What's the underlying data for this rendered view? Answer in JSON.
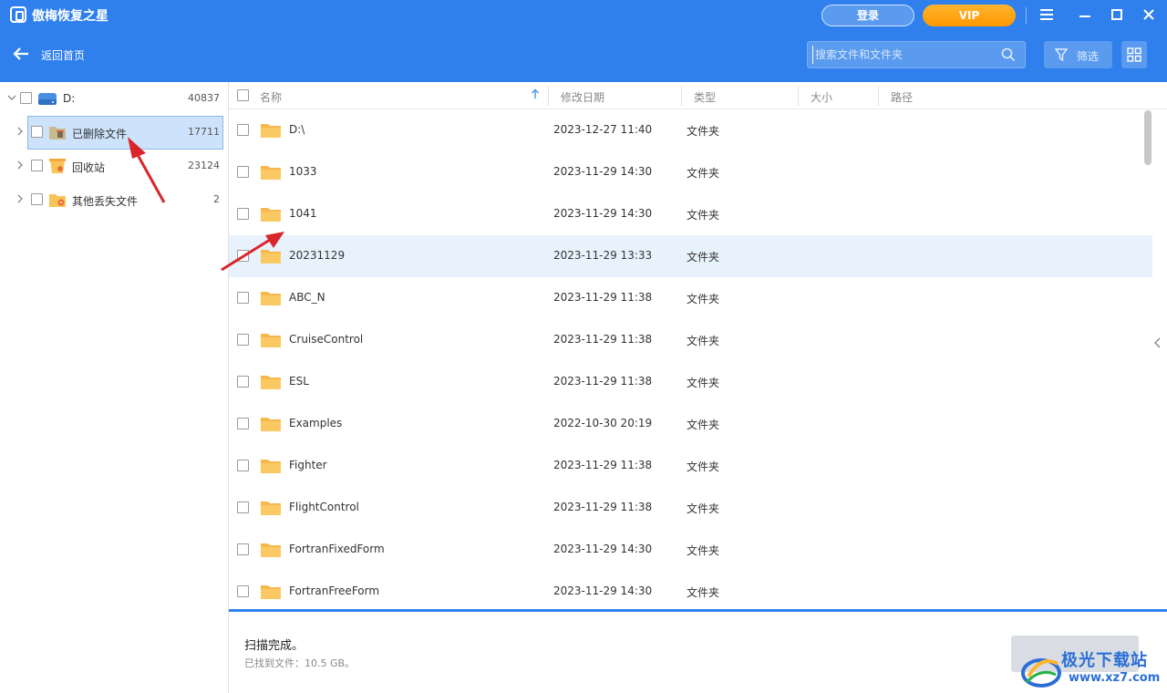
{
  "app": {
    "title": "傲梅恢复之星",
    "login_label": "登录",
    "vip_label": "VIP"
  },
  "toolbar": {
    "back_label": "返回首页",
    "search_placeholder": "搜索文件和文件夹",
    "filter_label": "筛选"
  },
  "sidebar": {
    "drive": {
      "label": "D:",
      "count": "40837"
    },
    "items": [
      {
        "label": "已删除文件",
        "count": "17711",
        "icon": "deleted-folder-icon",
        "selected": true
      },
      {
        "label": "回收站",
        "count": "23124",
        "icon": "recycle-bin-icon",
        "selected": false
      },
      {
        "label": "其他丢失文件",
        "count": "2",
        "icon": "lost-files-icon",
        "selected": false
      }
    ]
  },
  "table": {
    "columns": [
      "名称",
      "修改日期",
      "类型",
      "大小",
      "路径"
    ],
    "rows": [
      {
        "name": "D:\\",
        "date": "2023-12-27 11:40",
        "type": "文件夹"
      },
      {
        "name": "1033",
        "date": "2023-11-29 14:30",
        "type": "文件夹"
      },
      {
        "name": "1041",
        "date": "2023-11-29 14:30",
        "type": "文件夹"
      },
      {
        "name": "20231129",
        "date": "2023-11-29 13:33",
        "type": "文件夹"
      },
      {
        "name": "ABC_N",
        "date": "2023-11-29 11:38",
        "type": "文件夹"
      },
      {
        "name": "CruiseControl",
        "date": "2023-11-29 11:38",
        "type": "文件夹"
      },
      {
        "name": "ESL",
        "date": "2023-11-29 11:38",
        "type": "文件夹"
      },
      {
        "name": "Examples",
        "date": "2022-10-30 20:19",
        "type": "文件夹"
      },
      {
        "name": "Fighter",
        "date": "2023-11-29 11:38",
        "type": "文件夹"
      },
      {
        "name": "FlightControl",
        "date": "2023-11-29 11:38",
        "type": "文件夹"
      },
      {
        "name": "FortranFixedForm",
        "date": "2023-11-29 14:30",
        "type": "文件夹"
      },
      {
        "name": "FortranFreeForm",
        "date": "2023-11-29 14:30",
        "type": "文件夹"
      }
    ]
  },
  "footer": {
    "status": "扫描完成。",
    "found": "已找到文件：10.5 GB。"
  },
  "watermark": {
    "brand": "极光下载站",
    "url": "www.xz7.com"
  },
  "colors": {
    "header": "#2f80ed",
    "vip": "#ff9800",
    "selected_row": "#cde3fb",
    "highlight_row": "#e8f2fd",
    "folder": "#f9c35a",
    "annotation_arrow": "#d9262a"
  }
}
